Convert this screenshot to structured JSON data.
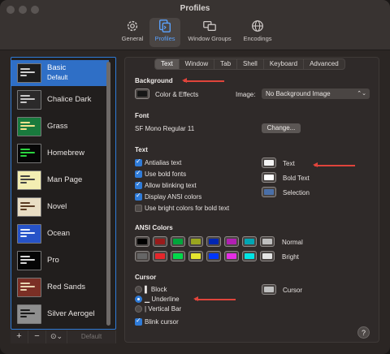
{
  "window": {
    "title": "Profiles"
  },
  "toolbar": {
    "items": [
      {
        "label": "General",
        "icon": "gear-icon"
      },
      {
        "label": "Profiles",
        "icon": "profiles-icon"
      },
      {
        "label": "Window Groups",
        "icon": "window-groups-icon"
      },
      {
        "label": "Encodings",
        "icon": "globe-icon"
      }
    ]
  },
  "profiles": {
    "items": [
      {
        "name": "Basic",
        "sub": "Default",
        "bg": "#1d1d1d",
        "fg": "#cfcfcf"
      },
      {
        "name": "Chalice Dark",
        "bg": "#2b2a2a",
        "fg": "#c8c8c8"
      },
      {
        "name": "Grass",
        "bg": "#197a3d",
        "fg": "#f2e18c"
      },
      {
        "name": "Homebrew",
        "bg": "#060606",
        "fg": "#2bd43f"
      },
      {
        "name": "Man Page",
        "bg": "#f3eeb2",
        "fg": "#444444"
      },
      {
        "name": "Novel",
        "bg": "#e9dec4",
        "fg": "#5a3b22"
      },
      {
        "name": "Ocean",
        "bg": "#2653c8",
        "fg": "#e8f0ff"
      },
      {
        "name": "Pro",
        "bg": "#050505",
        "fg": "#d8d8d8"
      },
      {
        "name": "Red Sands",
        "bg": "#7b2f25",
        "fg": "#e8d5b0"
      },
      {
        "name": "Silver Aerogel",
        "bg": "#8e8e8e",
        "fg": "#1a1a1a"
      }
    ],
    "add_label": "+",
    "remove_label": "−",
    "more_label": "⊙⌄",
    "default_label": "Default"
  },
  "tabs": [
    "Text",
    "Window",
    "Tab",
    "Shell",
    "Keyboard",
    "Advanced"
  ],
  "background": {
    "heading": "Background",
    "color_label": "Color & Effects",
    "color": "#161616",
    "image_label": "Image:",
    "image_value": "No Background Image"
  },
  "font": {
    "heading": "Font",
    "value": "SF Mono Regular 11",
    "change_label": "Change..."
  },
  "text": {
    "heading": "Text",
    "options": [
      {
        "label": "Antialias text",
        "checked": true
      },
      {
        "label": "Use bold fonts",
        "checked": true
      },
      {
        "label": "Allow blinking text",
        "checked": true
      },
      {
        "label": "Display ANSI colors",
        "checked": true
      },
      {
        "label": "Use bright colors for bold text",
        "checked": false
      }
    ],
    "colors": [
      {
        "label": "Text",
        "color": "#f4f4f4"
      },
      {
        "label": "Bold Text",
        "color": "#ffffff"
      },
      {
        "label": "Selection",
        "color": "#4a6fa8"
      }
    ]
  },
  "ansi": {
    "heading": "ANSI Colors",
    "normal_label": "Normal",
    "bright_label": "Bright",
    "normal": [
      "#000000",
      "#991b1b",
      "#00a63b",
      "#9aa61f",
      "#0026b3",
      "#b21fb3",
      "#00a6b3",
      "#bfbfbf"
    ],
    "bright": [
      "#666666",
      "#e5262b",
      "#00d94a",
      "#e5e52e",
      "#0036ff",
      "#e52ee5",
      "#00e5e5",
      "#e5e5e5"
    ]
  },
  "cursor": {
    "heading": "Cursor",
    "options": [
      {
        "label": "▌ Block",
        "selected": false
      },
      {
        "label": "▁ Underline",
        "selected": true
      },
      {
        "label": "|  Vertical Bar",
        "selected": false
      }
    ],
    "color_label": "Cursor",
    "color": "#c0c0c0",
    "blink_label": "Blink cursor",
    "blink": true
  },
  "help_label": "?"
}
